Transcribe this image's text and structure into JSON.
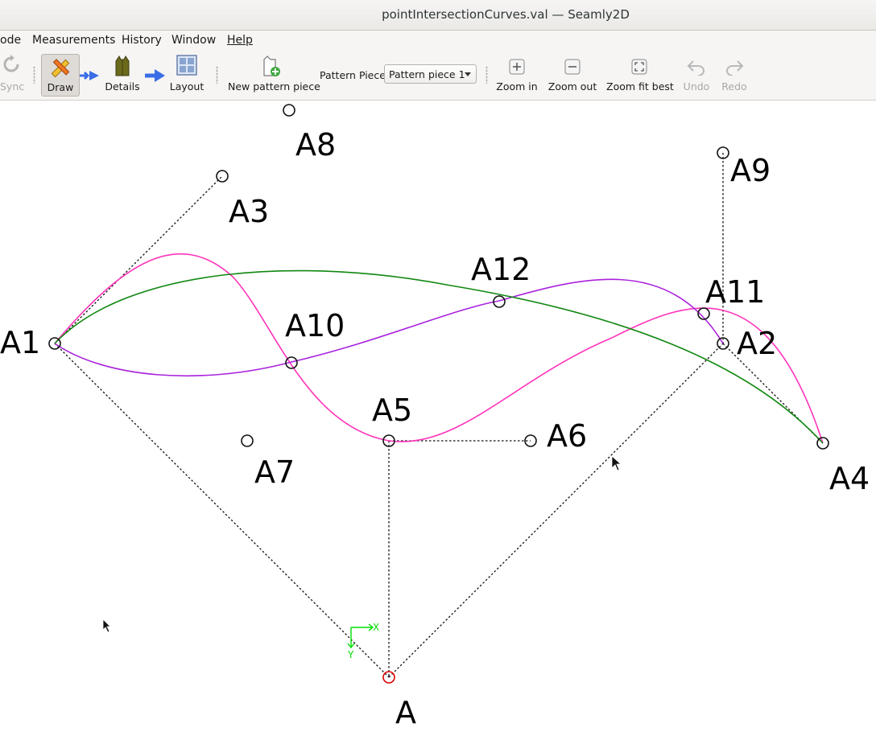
{
  "window": {
    "title": "pointIntersectionCurves.val — Seamly2D"
  },
  "menu": {
    "items": [
      "ode",
      "Measurements",
      "History",
      "Window",
      "Help"
    ]
  },
  "toolbar": {
    "sync_label": "Sync",
    "draw_label": "Draw",
    "details_label": "Details",
    "layout_label": "Layout",
    "new_piece_label": "New pattern piece",
    "pattern_piece_label": "Pattern Piece:",
    "pattern_piece_value": "Pattern piece 1",
    "zoom_in_label": "Zoom in",
    "zoom_out_label": "Zoom out",
    "zoom_fit_label": "Zoom fit best",
    "undo_label": "Undo",
    "redo_label": "Redo"
  },
  "canvas": {
    "points": {
      "A": "A",
      "A1": "A1",
      "A2": "A2",
      "A3": "A3",
      "A4": "A4",
      "A5": "A5",
      "A6": "A6",
      "A7": "A7",
      "A8": "A8",
      "A9": "A9",
      "A10": "A10",
      "A11": "A11",
      "A12": "A12"
    },
    "axis": {
      "x": "X",
      "y": "Y"
    },
    "colors": {
      "spline_magenta": "#ff33bb",
      "spline_purple": "#aa22dd",
      "spline_green": "#118811",
      "origin_point": "#dd0000",
      "axis_indicator": "#00dd00"
    }
  }
}
